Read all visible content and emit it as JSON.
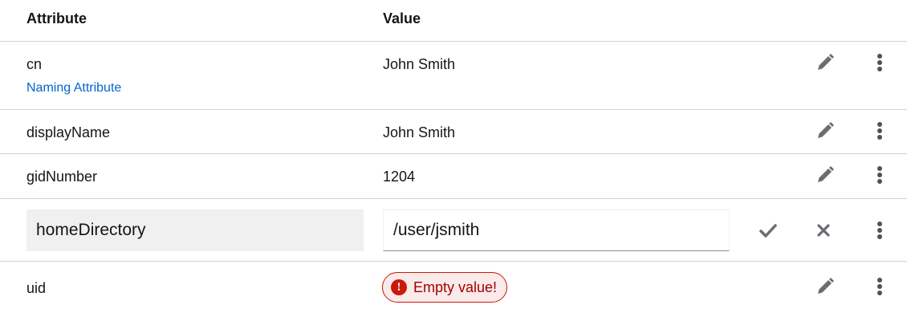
{
  "header": {
    "attribute_label": "Attribute",
    "value_label": "Value"
  },
  "rows": [
    {
      "attribute": "cn",
      "sublabel": "Naming Attribute",
      "value": "John Smith"
    },
    {
      "attribute": "displayName",
      "value": "John Smith"
    },
    {
      "attribute": "gidNumber",
      "value": "1204"
    },
    {
      "attribute": "homeDirectory",
      "value": "/user/jsmith",
      "editing": true
    },
    {
      "attribute": "uid",
      "error": "Empty value!",
      "error_icon": "exclamation-circle-icon"
    }
  ],
  "icons": {
    "edit": "pencil-icon",
    "kebab": "kebab-menu-icon",
    "confirm": "check-icon",
    "cancel": "close-icon"
  },
  "colors": {
    "link": "#0066cc",
    "error_border": "#c9190b",
    "error_bg": "#faeaea",
    "error_text": "#a30000",
    "icon_gray": "#6a6e73",
    "edit_field_bg": "#f0f0f0"
  }
}
